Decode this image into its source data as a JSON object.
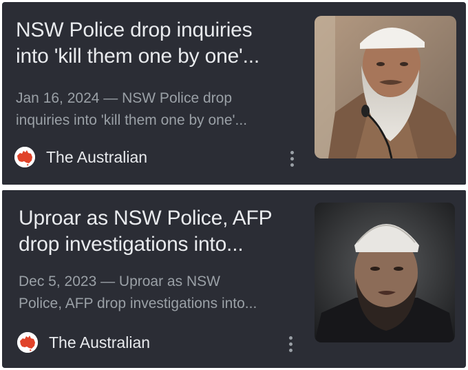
{
  "results": [
    {
      "headline_line1": "NSW Police drop inquiries",
      "headline_line2": "into 'kill them one by one'...",
      "snippet_line1": "Jan 16, 2024 — NSW Police drop",
      "snippet_line2": "inquiries into 'kill them one by one'...",
      "source": "The Australian",
      "thumbnail": "bearded-man-white-cap-microphone"
    },
    {
      "headline_line1": "Uproar as NSW Police, AFP",
      "headline_line2": "drop investigations into...",
      "snippet_line1": "Dec 5, 2023 — Uproar as NSW",
      "snippet_line2": "Police, AFP drop investigations into...",
      "source": "The Australian",
      "thumbnail": "bearded-man-white-knit-cap"
    }
  ],
  "colors": {
    "card_bg": "#2b2d35",
    "headline": "#e8eaed",
    "snippet": "#9aa0a6",
    "logo_red": "#e0432a"
  },
  "icons": {
    "source_logo": "australia-map-logo-icon",
    "more": "more-vert-icon"
  }
}
